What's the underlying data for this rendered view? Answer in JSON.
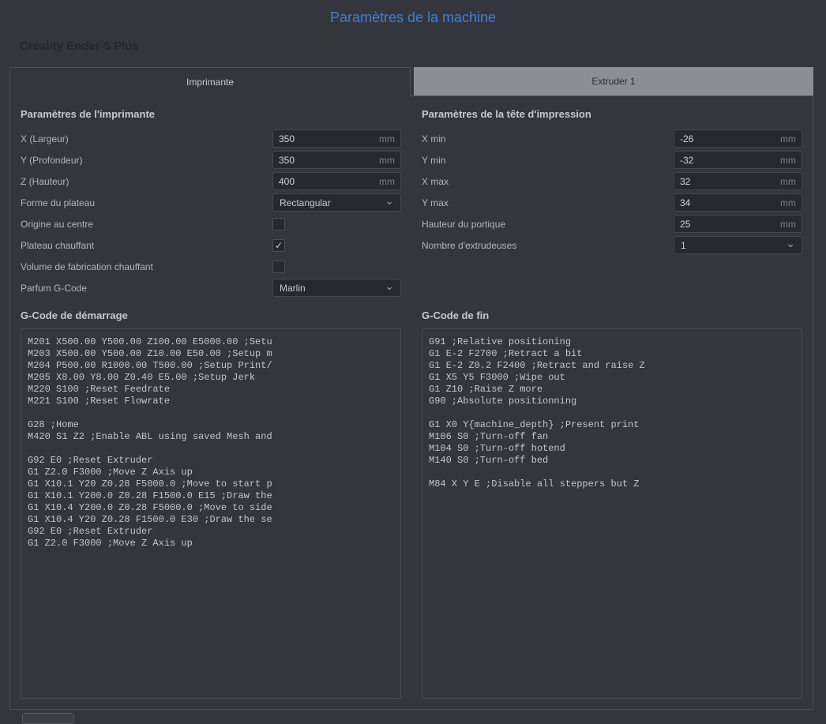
{
  "header": {
    "title": "Paramètres de la machine",
    "machine_name": "Creality Ender-5 Plus"
  },
  "tabs": [
    {
      "label": "Imprimante"
    },
    {
      "label": "Extruder 1"
    }
  ],
  "icons": {
    "chevron_down": "⌄",
    "checkmark": "✓"
  },
  "printer": {
    "heading": "Paramètres de l'imprimante",
    "rows": [
      {
        "label": "X (Largeur)",
        "value": "350",
        "unit": "mm"
      },
      {
        "label": "Y (Profondeur)",
        "value": "350",
        "unit": "mm"
      },
      {
        "label": "Z (Hauteur)",
        "value": "400",
        "unit": "mm"
      },
      {
        "label": "Forme du plateau",
        "value": "Rectangular"
      },
      {
        "label": "Origine au centre",
        "checkbox": ""
      },
      {
        "label": "Plateau chauffant",
        "checkbox": "✓"
      },
      {
        "label": "Volume de fabrication chauffant",
        "checkbox": ""
      },
      {
        "label": "Parfum G-Code",
        "value": "Marlin"
      }
    ]
  },
  "printhead": {
    "heading": "Paramètres de la tête d'impression",
    "rows": [
      {
        "label": "X min",
        "value": "-26",
        "unit": "mm"
      },
      {
        "label": "Y min",
        "value": "-32",
        "unit": "mm"
      },
      {
        "label": "X max",
        "value": "32",
        "unit": "mm"
      },
      {
        "label": "Y max",
        "value": "34",
        "unit": "mm"
      },
      {
        "label": "Hauteur du portique",
        "value": "25",
        "unit": "mm"
      },
      {
        "label": "Nombre d'extrudeuses",
        "value": "1"
      }
    ]
  },
  "gcode_start": {
    "heading": "G-Code de démarrage",
    "value": "M201 X500.00 Y500.00 Z100.00 E5000.00 ;Setu\nM203 X500.00 Y500.00 Z10.00 E50.00 ;Setup m\nM204 P500.00 R1000.00 T500.00 ;Setup Print/\nM205 X8.00 Y8.00 Z0.40 E5.00 ;Setup Jerk\nM220 S100 ;Reset Feedrate\nM221 S100 ;Reset Flowrate\n\nG28 ;Home\nM420 S1 Z2 ;Enable ABL using saved Mesh and\n\nG92 E0 ;Reset Extruder\nG1 Z2.0 F3000 ;Move Z Axis up\nG1 X10.1 Y20 Z0.28 F5000.0 ;Move to start p\nG1 X10.1 Y200.0 Z0.28 F1500.0 E15 ;Draw the\nG1 X10.4 Y200.0 Z0.28 F5000.0 ;Move to side\nG1 X10.4 Y20 Z0.28 F1500.0 E30 ;Draw the se\nG92 E0 ;Reset Extruder\nG1 Z2.0 F3000 ;Move Z Axis up"
  },
  "gcode_end": {
    "heading": "G-Code de fin",
    "value": "G91 ;Relative positioning\nG1 E-2 F2700 ;Retract a bit\nG1 E-2 Z0.2 F2400 ;Retract and raise Z\nG1 X5 Y5 F3000 ;Wipe out\nG1 Z10 ;Raise Z more\nG90 ;Absolute positionning\n\nG1 X0 Y{machine_depth} ;Present print\nM106 S0 ;Turn-off fan\nM104 S0 ;Turn-off hotend\nM140 S0 ;Turn-off bed\n\nM84 X Y E ;Disable all steppers but Z"
  }
}
